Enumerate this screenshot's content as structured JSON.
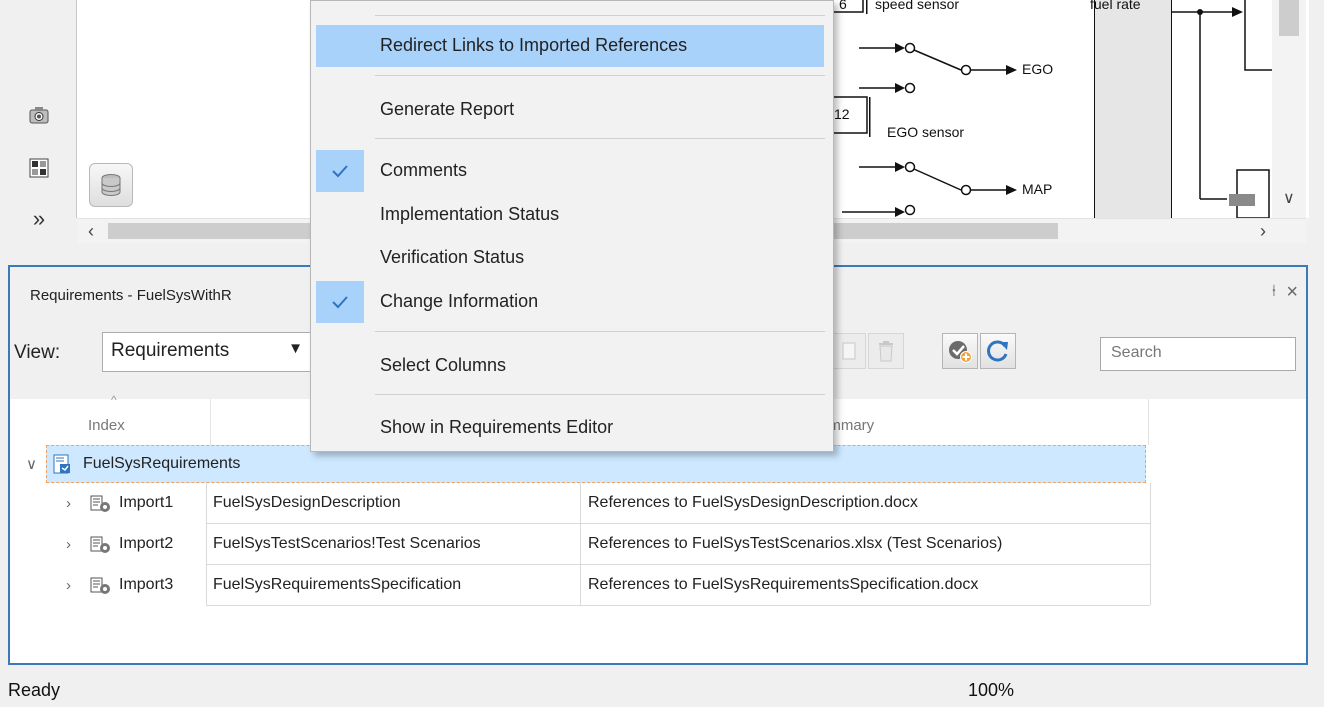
{
  "context_menu": {
    "items": [
      {
        "label": "Redirect Links to Imported References",
        "highlighted": true,
        "checked": false
      },
      {
        "label": "Generate Report",
        "highlighted": false,
        "checked": false
      },
      {
        "label": "Comments",
        "highlighted": false,
        "checked": true
      },
      {
        "label": "Implementation Status",
        "highlighted": false,
        "checked": false
      },
      {
        "label": "Verification Status",
        "highlighted": false,
        "checked": false
      },
      {
        "label": "Change Information",
        "highlighted": false,
        "checked": true
      },
      {
        "label": "Select Columns",
        "highlighted": false,
        "checked": false
      },
      {
        "label": "Show in Requirements Editor",
        "highlighted": false,
        "checked": false
      }
    ]
  },
  "diagram": {
    "labels": {
      "speed_sensor": "speed sensor",
      "fuel_rate": "fuel rate",
      "ego": "EGO",
      "ego_sensor": "EGO sensor",
      "map": "MAP",
      "block_6": "6",
      "block_12": "12"
    }
  },
  "panel": {
    "title": "Requirements - FuelSysWithR",
    "view_label": "View:",
    "view_value": "Requirements",
    "search_placeholder": "Search",
    "columns": {
      "index": "Index",
      "summary": "ummary"
    },
    "root": {
      "label": "FuelSysRequirements"
    },
    "rows": [
      {
        "index": "Import1",
        "id": "FuelSysDesignDescription",
        "summary": "References to FuelSysDesignDescription.docx"
      },
      {
        "index": "Import2",
        "id": "FuelSysTestScenarios!Test Scenarios",
        "summary": "References to FuelSysTestScenarios.xlsx (Test Scenarios)"
      },
      {
        "index": "Import3",
        "id": "FuelSysRequirementsSpecification",
        "summary": "References to FuelSysRequirementsSpecification.docx"
      }
    ]
  },
  "status_bar": {
    "status": "Ready",
    "zoom": "100%"
  },
  "icons": {
    "toolbar": [
      "camera-icon",
      "image-icon",
      "double-chevron-right-icon"
    ],
    "panel_tools": [
      "delete-icon",
      "add-link-icon",
      "refresh-icon"
    ]
  }
}
